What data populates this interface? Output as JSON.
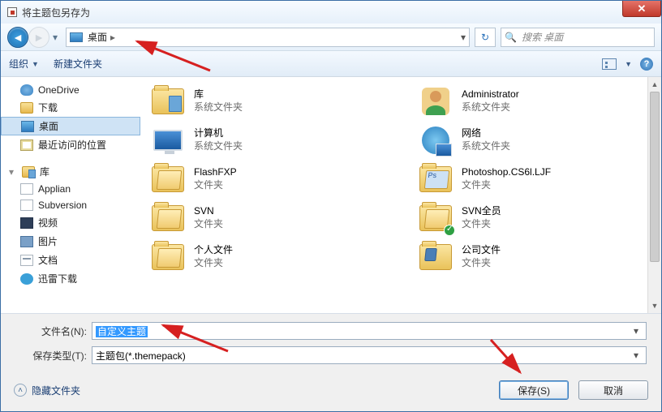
{
  "titlebar": {
    "title": "将主题包另存为"
  },
  "nav": {
    "location_label": "桌面",
    "crumb_sep": "▸",
    "search_placeholder": "搜索 桌面"
  },
  "toolbar": {
    "organize": "组织",
    "newfolder": "新建文件夹"
  },
  "tree": {
    "fav_head": "",
    "fav": [
      {
        "icon": "cloud",
        "label": "OneDrive"
      },
      {
        "icon": "dl",
        "label": "下载"
      },
      {
        "icon": "desk",
        "label": "桌面",
        "selected": true
      },
      {
        "icon": "rec",
        "label": "最近访问的位置"
      }
    ],
    "lib_head": "库",
    "lib": [
      {
        "icon": "app",
        "label": "Applian"
      },
      {
        "icon": "app",
        "label": "Subversion"
      },
      {
        "icon": "vid",
        "label": "视频"
      },
      {
        "icon": "pic",
        "label": "图片"
      },
      {
        "icon": "doc",
        "label": "文档"
      },
      {
        "icon": "thu",
        "label": "迅雷下载"
      }
    ]
  },
  "items": [
    {
      "kind": "lib",
      "title": "库",
      "sub": "系统文件夹"
    },
    {
      "kind": "avatar",
      "title": "Administrator",
      "sub": "系统文件夹"
    },
    {
      "kind": "monitor",
      "title": "计算机",
      "sub": "系统文件夹"
    },
    {
      "kind": "globe",
      "title": "网络",
      "sub": "系统文件夹"
    },
    {
      "kind": "folder",
      "title": "FlashFXP",
      "sub": "文件夹"
    },
    {
      "kind": "ps",
      "title": "Photoshop.CS6l.LJF",
      "sub": "文件夹"
    },
    {
      "kind": "folder",
      "title": "SVN",
      "sub": "文件夹"
    },
    {
      "kind": "ok",
      "title": "SVN全员",
      "sub": "文件夹"
    },
    {
      "kind": "folder",
      "title": "个人文件",
      "sub": "文件夹"
    },
    {
      "kind": "word",
      "title": "公司文件",
      "sub": "文件夹"
    }
  ],
  "fields": {
    "filename_label": "文件名(N):",
    "filename_value": "自定义主题",
    "type_label": "保存类型(T):",
    "type_value": "主题包(*.themepack)"
  },
  "footer": {
    "hide": "隐藏文件夹",
    "save": "保存(S)",
    "cancel": "取消"
  }
}
